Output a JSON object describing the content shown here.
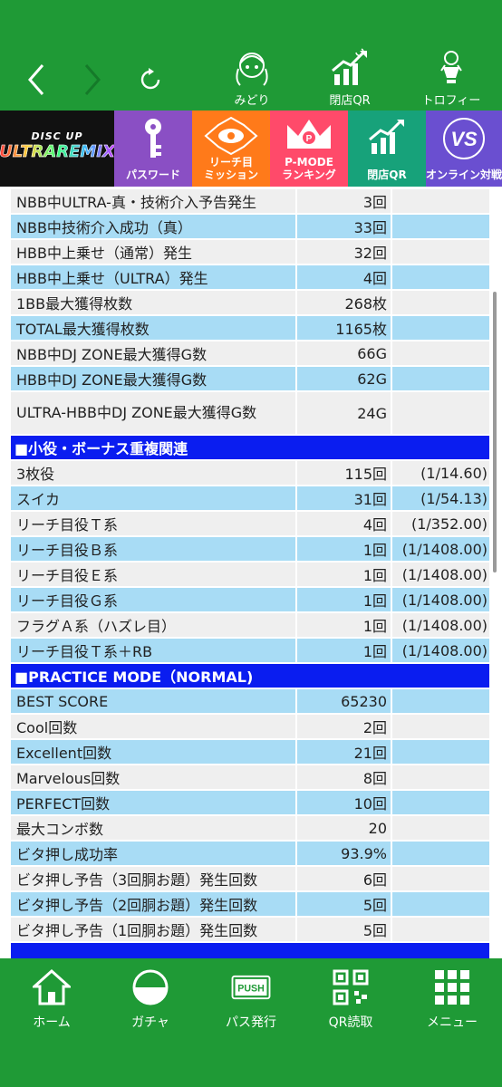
{
  "top_nav": {
    "items": [
      {
        "label": "みどり",
        "icon": "character-icon"
      },
      {
        "label": "閉店QR",
        "icon": "chart-qr-icon"
      },
      {
        "label": "トロフィー",
        "icon": "trophy-icon"
      }
    ]
  },
  "logo": {
    "line1": "DISC UP",
    "line2": "ULTRAREMIX"
  },
  "tiles": [
    {
      "label": "パスワード",
      "color": "#8a4fc4",
      "icon": "key-icon"
    },
    {
      "label1": "リーチ目",
      "label2": "ミッション",
      "color": "#ff7a1a",
      "icon": "eye-badge-icon"
    },
    {
      "label1": "P-MODE",
      "label2": "ランキング",
      "color": "#ff4a6a",
      "icon": "crown-icon"
    },
    {
      "label": "閉店QR",
      "color": "#17a27a",
      "icon": "chart-qr-icon"
    },
    {
      "label": "オンライン対戦",
      "color": "#6a4fd0",
      "icon": "online-vs-icon"
    }
  ],
  "rows_a": [
    {
      "name": "NBB中ULTRA-真・技術介入予告発生",
      "value": "3回",
      "extra": "",
      "style": "gray"
    },
    {
      "name": "NBB中技術介入成功（真）",
      "value": "33回",
      "extra": "",
      "style": "blue"
    },
    {
      "name": "HBB中上乗せ（通常）発生",
      "value": "32回",
      "extra": "",
      "style": "gray"
    },
    {
      "name": "HBB中上乗せ（ULTRA）発生",
      "value": "4回",
      "extra": "",
      "style": "blue"
    },
    {
      "name": "1BB最大獲得枚数",
      "value": "268枚",
      "extra": "",
      "style": "gray"
    },
    {
      "name": "TOTAL最大獲得枚数",
      "value": "1165枚",
      "extra": "",
      "style": "blue"
    },
    {
      "name": "NBB中DJ ZONE最大獲得G数",
      "value": "66G",
      "extra": "",
      "style": "gray"
    },
    {
      "name": "HBB中DJ ZONE最大獲得G数",
      "value": "62G",
      "extra": "",
      "style": "blue"
    }
  ],
  "row_tall": {
    "name": "ULTRA-HBB中DJ ZONE最大獲得G数",
    "value": "24G",
    "extra": ""
  },
  "section1": "■小役・ボーナス重複関連",
  "rows_b": [
    {
      "name": "3枚役",
      "value": "115回",
      "extra": "(1/14.60)",
      "style": "gray"
    },
    {
      "name": "スイカ",
      "value": "31回",
      "extra": "(1/54.13)",
      "style": "blue"
    },
    {
      "name": "リーチ目役Ｔ系",
      "value": "4回",
      "extra": "(1/352.00)",
      "style": "gray"
    },
    {
      "name": "リーチ目役Ｂ系",
      "value": "1回",
      "extra": "(1/1408.00)",
      "style": "blue"
    },
    {
      "name": "リーチ目役Ｅ系",
      "value": "1回",
      "extra": "(1/1408.00)",
      "style": "gray"
    },
    {
      "name": "リーチ目役Ｇ系",
      "value": "1回",
      "extra": "(1/1408.00)",
      "style": "blue"
    },
    {
      "name": "フラグＡ系（ハズレ目）",
      "value": "1回",
      "extra": "(1/1408.00)",
      "style": "gray"
    },
    {
      "name": "リーチ目役Ｔ系＋RB",
      "value": "1回",
      "extra": "(1/1408.00)",
      "style": "blue"
    }
  ],
  "section2": "■PRACTICE MODE（NORMAL)",
  "rows_c": [
    {
      "name": "BEST SCORE",
      "value": "65230",
      "extra": "",
      "style": "blue"
    },
    {
      "name": "Cool回数",
      "value": "2回",
      "extra": "",
      "style": "gray"
    },
    {
      "name": "Excellent回数",
      "value": "21回",
      "extra": "",
      "style": "blue"
    },
    {
      "name": "Marvelous回数",
      "value": "8回",
      "extra": "",
      "style": "gray"
    },
    {
      "name": "PERFECT回数",
      "value": "10回",
      "extra": "",
      "style": "blue"
    },
    {
      "name": "最大コンボ数",
      "value": "20",
      "extra": "",
      "style": "gray"
    },
    {
      "name": "ビタ押し成功率",
      "value": "93.9%",
      "extra": "",
      "style": "blue"
    },
    {
      "name": "ビタ押し予告（3回胴お題）発生回数",
      "value": "6回",
      "extra": "",
      "style": "gray"
    },
    {
      "name": "ビタ押し予告（2回胴お題）発生回数",
      "value": "5回",
      "extra": "",
      "style": "blue"
    },
    {
      "name": "ビタ押し予告（1回胴お題）発生回数",
      "value": "5回",
      "extra": "",
      "style": "gray"
    }
  ],
  "bottom_nav": [
    {
      "label": "ホーム",
      "icon": "home-icon"
    },
    {
      "label": "ガチャ",
      "icon": "gacha-icon"
    },
    {
      "label": "パス発行",
      "icon": "push-icon"
    },
    {
      "label": "QR読取",
      "icon": "qr-icon"
    },
    {
      "label": "メニュー",
      "icon": "grid-menu-icon"
    }
  ],
  "colors": {
    "green": "#1f9a36",
    "row_blue": "#a8dcf5",
    "row_gray": "#efefef",
    "section_blue": "#0a1df0"
  }
}
